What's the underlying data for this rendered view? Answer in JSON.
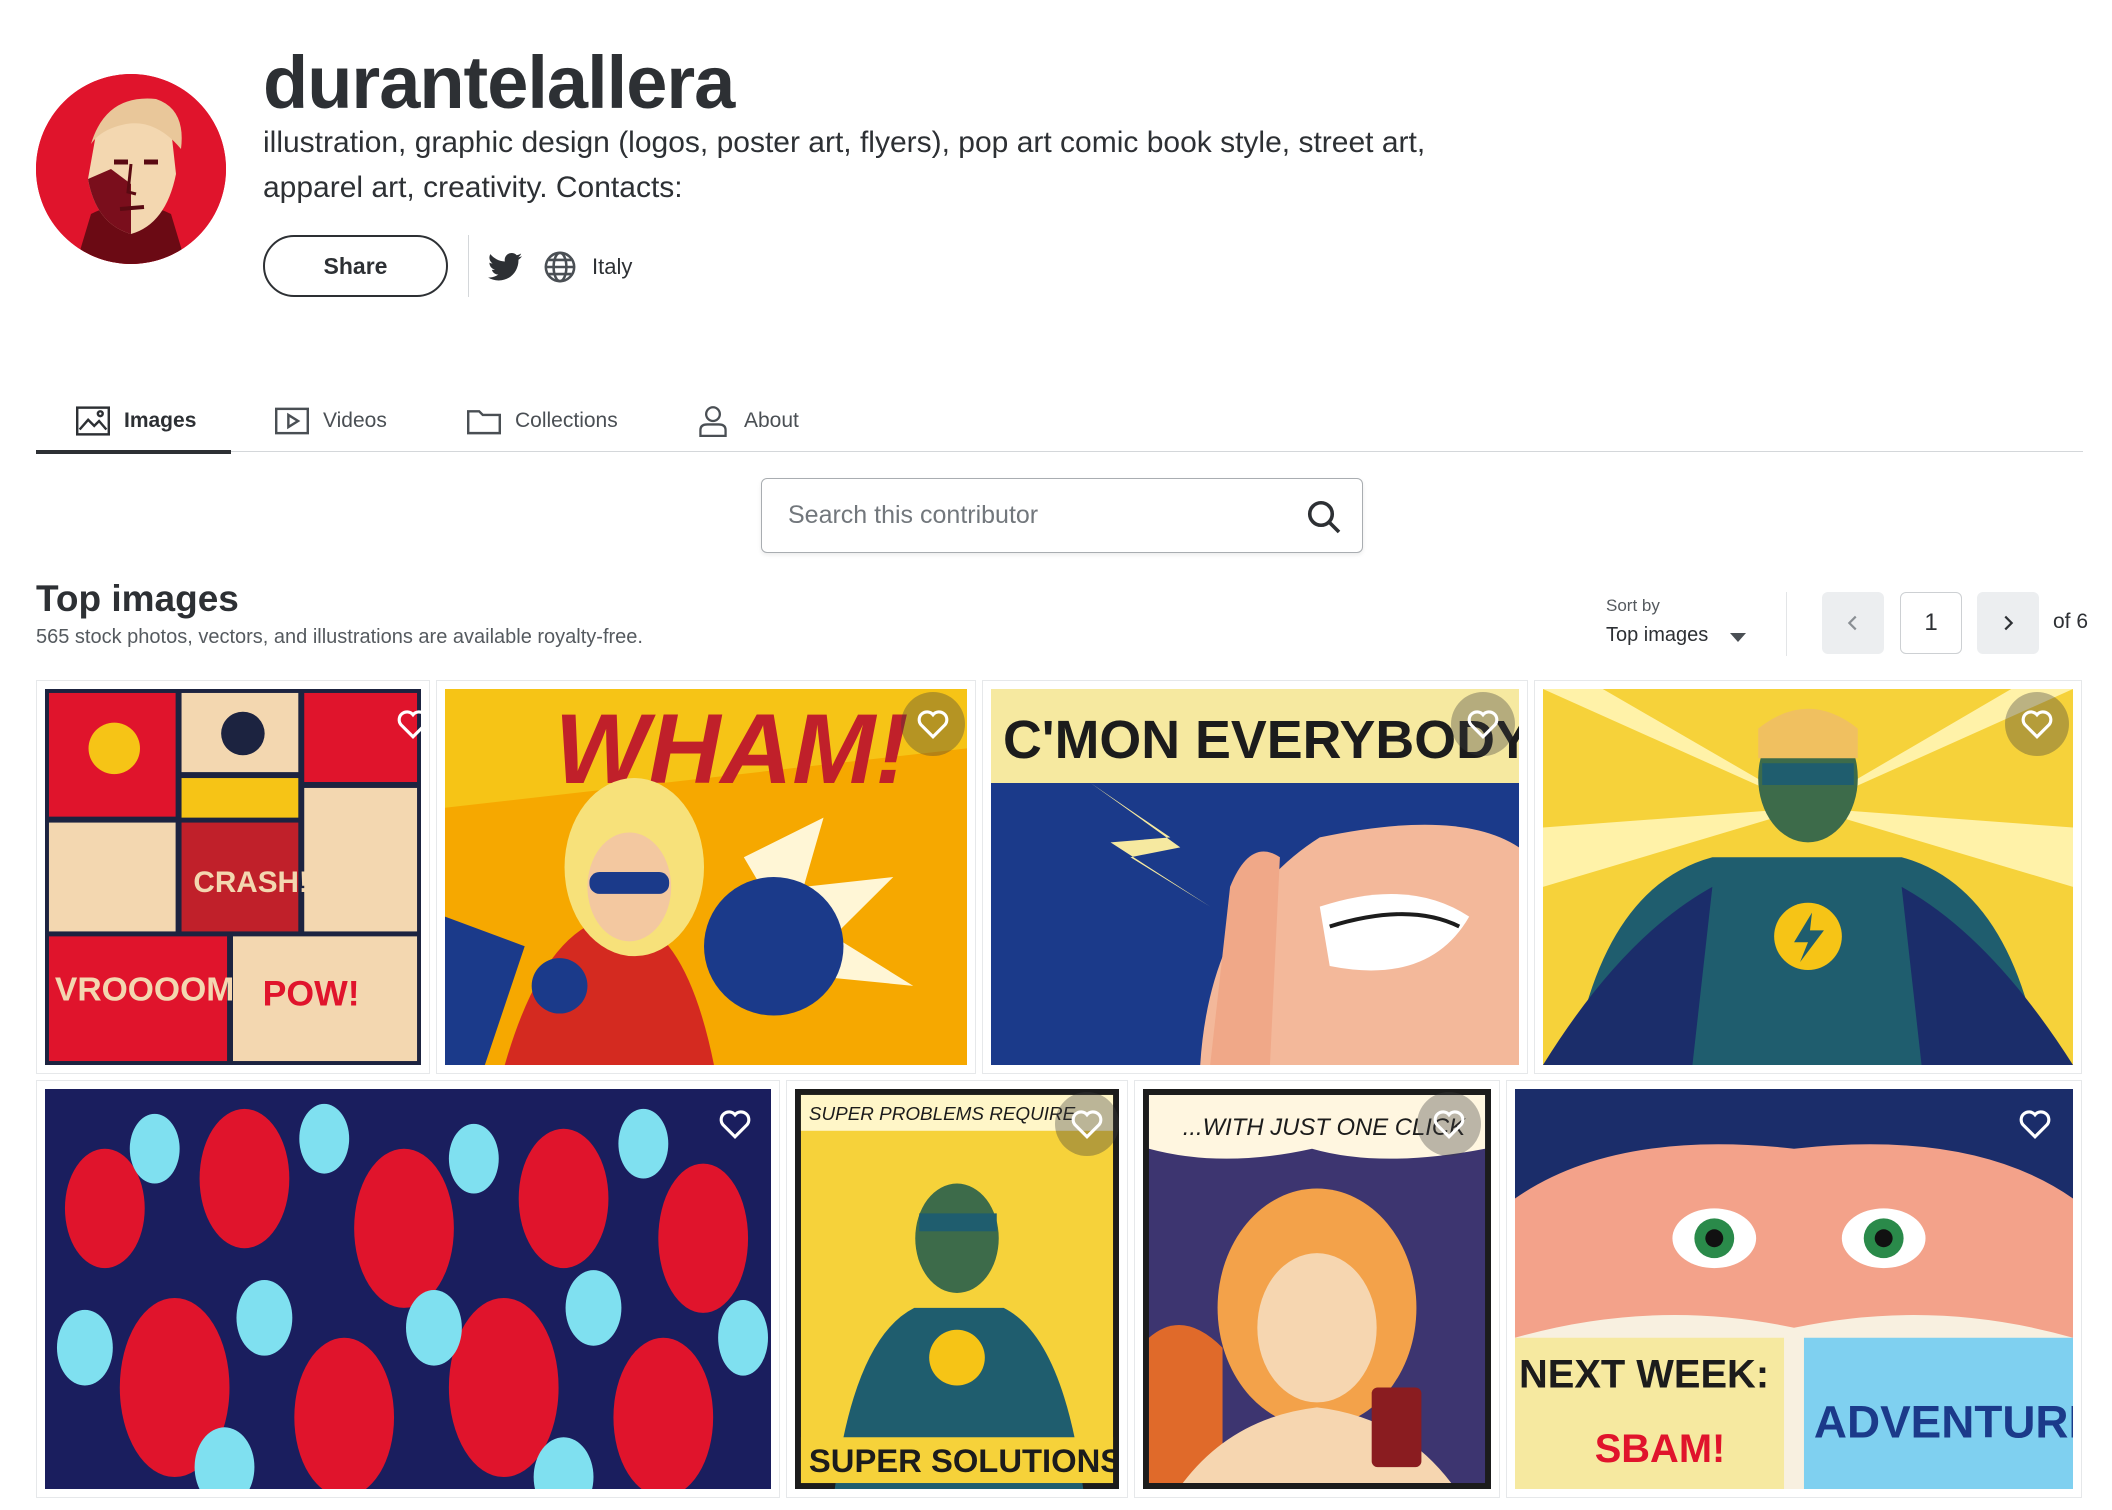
{
  "profile": {
    "username": "durantelallera",
    "bio": "illustration, graphic design (logos, poster art, flyers), pop art comic book style, street art, apparel art, creativity. Contacts:",
    "share_label": "Share",
    "location": "Italy",
    "icons": [
      "avatar",
      "twitter-icon",
      "globe-icon"
    ]
  },
  "tabs": [
    {
      "label": "Images",
      "icon": "image-icon",
      "active": true
    },
    {
      "label": "Videos",
      "icon": "video-icon",
      "active": false
    },
    {
      "label": "Collections",
      "icon": "folder-icon",
      "active": false
    },
    {
      "label": "About",
      "icon": "person-icon",
      "active": false
    }
  ],
  "search": {
    "placeholder": "Search this contributor",
    "icon": "search-icon"
  },
  "section": {
    "title": "Top images",
    "subtitle": "565 stock photos, vectors, and illustrations are available royalty-free."
  },
  "sort": {
    "label": "Sort by",
    "value": "Top images"
  },
  "pagination": {
    "current": "1",
    "of_label": "of 6"
  },
  "images": {
    "wham_text": "WHAM!",
    "cmon_text": "C'MON EVERYBODY!",
    "super_problems_text": "SUPER PROBLEMS REQUIRE",
    "super_solutions_text": "SUPER SOLUTIONS",
    "one_click_text": "...WITH JUST ONE CLICK",
    "next_week_text": "NEXT WEEK:",
    "adventure_text": "ADVENTURE",
    "crash_text": "CRASH!",
    "vroooom_text": "VROOOOM",
    "pow_text": "POW!",
    "sbam_text": "SBAM!"
  },
  "colors": {
    "text_dark": "#2d3034",
    "border": "#d4d7da",
    "pop_red": "#e0142c",
    "pop_yellow": "#f6c416",
    "pop_blue": "#1b3a8a",
    "pop_teal": "#1f5d6e"
  }
}
